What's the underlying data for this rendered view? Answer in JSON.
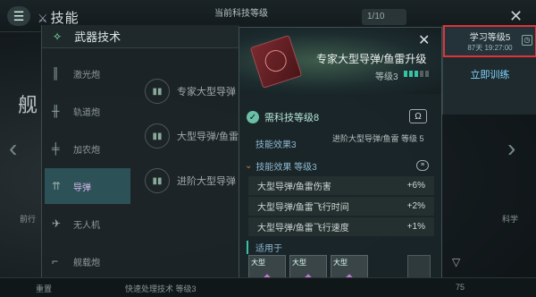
{
  "topbar": {
    "title": "技能",
    "current_level_label": "当前科技等级",
    "pill": "1/10"
  },
  "panel": {
    "title": "武器技术",
    "categories": [
      {
        "label": "激光炮",
        "icon": "laser-icon"
      },
      {
        "label": "轨道炮",
        "icon": "railgun-icon"
      },
      {
        "label": "加农炮",
        "icon": "cannon-icon"
      },
      {
        "label": "导弹",
        "icon": "missile-icon"
      },
      {
        "label": "无人机",
        "icon": "drone-icon"
      },
      {
        "label": "舰载炮",
        "icon": "ship-gun-icon"
      }
    ],
    "rows": [
      {
        "label": "专家大型导弹"
      },
      {
        "label": "大型导弹/鱼雷"
      },
      {
        "label": "进阶大型导弹"
      }
    ],
    "side_big_label": "舰",
    "side_left_label": "前行",
    "side_right_label": "科学"
  },
  "dialog": {
    "title": "专家大型导弹/鱼雷升级",
    "level": "等级3",
    "pips_filled": 3,
    "pips_total": 5,
    "requirement": "需科技等级8",
    "effect_head": "技能效果3",
    "effect_next": "进阶大型导弹/鱼雷 等级 5",
    "effect_sub": "技能效果 等级3",
    "stats": [
      {
        "label": "大型导弹/鱼雷伤害",
        "value": "+6%"
      },
      {
        "label": "大型导弹/鱼雷飞行时间",
        "value": "+2%"
      },
      {
        "label": "大型导弹/鱼雷飞行速度",
        "value": "+1%"
      }
    ],
    "applies_to": "适用于",
    "ships": [
      {
        "label": "大型"
      },
      {
        "label": "大型"
      },
      {
        "label": "大型"
      }
    ],
    "more": "..."
  },
  "train": {
    "learn_label": "学习等级5",
    "learn_time": "87天 19:27:00",
    "train_button": "立即训练"
  },
  "bottom": {
    "left": "重置",
    "queue": "快速处理技术 等级3",
    "right_count": "75"
  }
}
